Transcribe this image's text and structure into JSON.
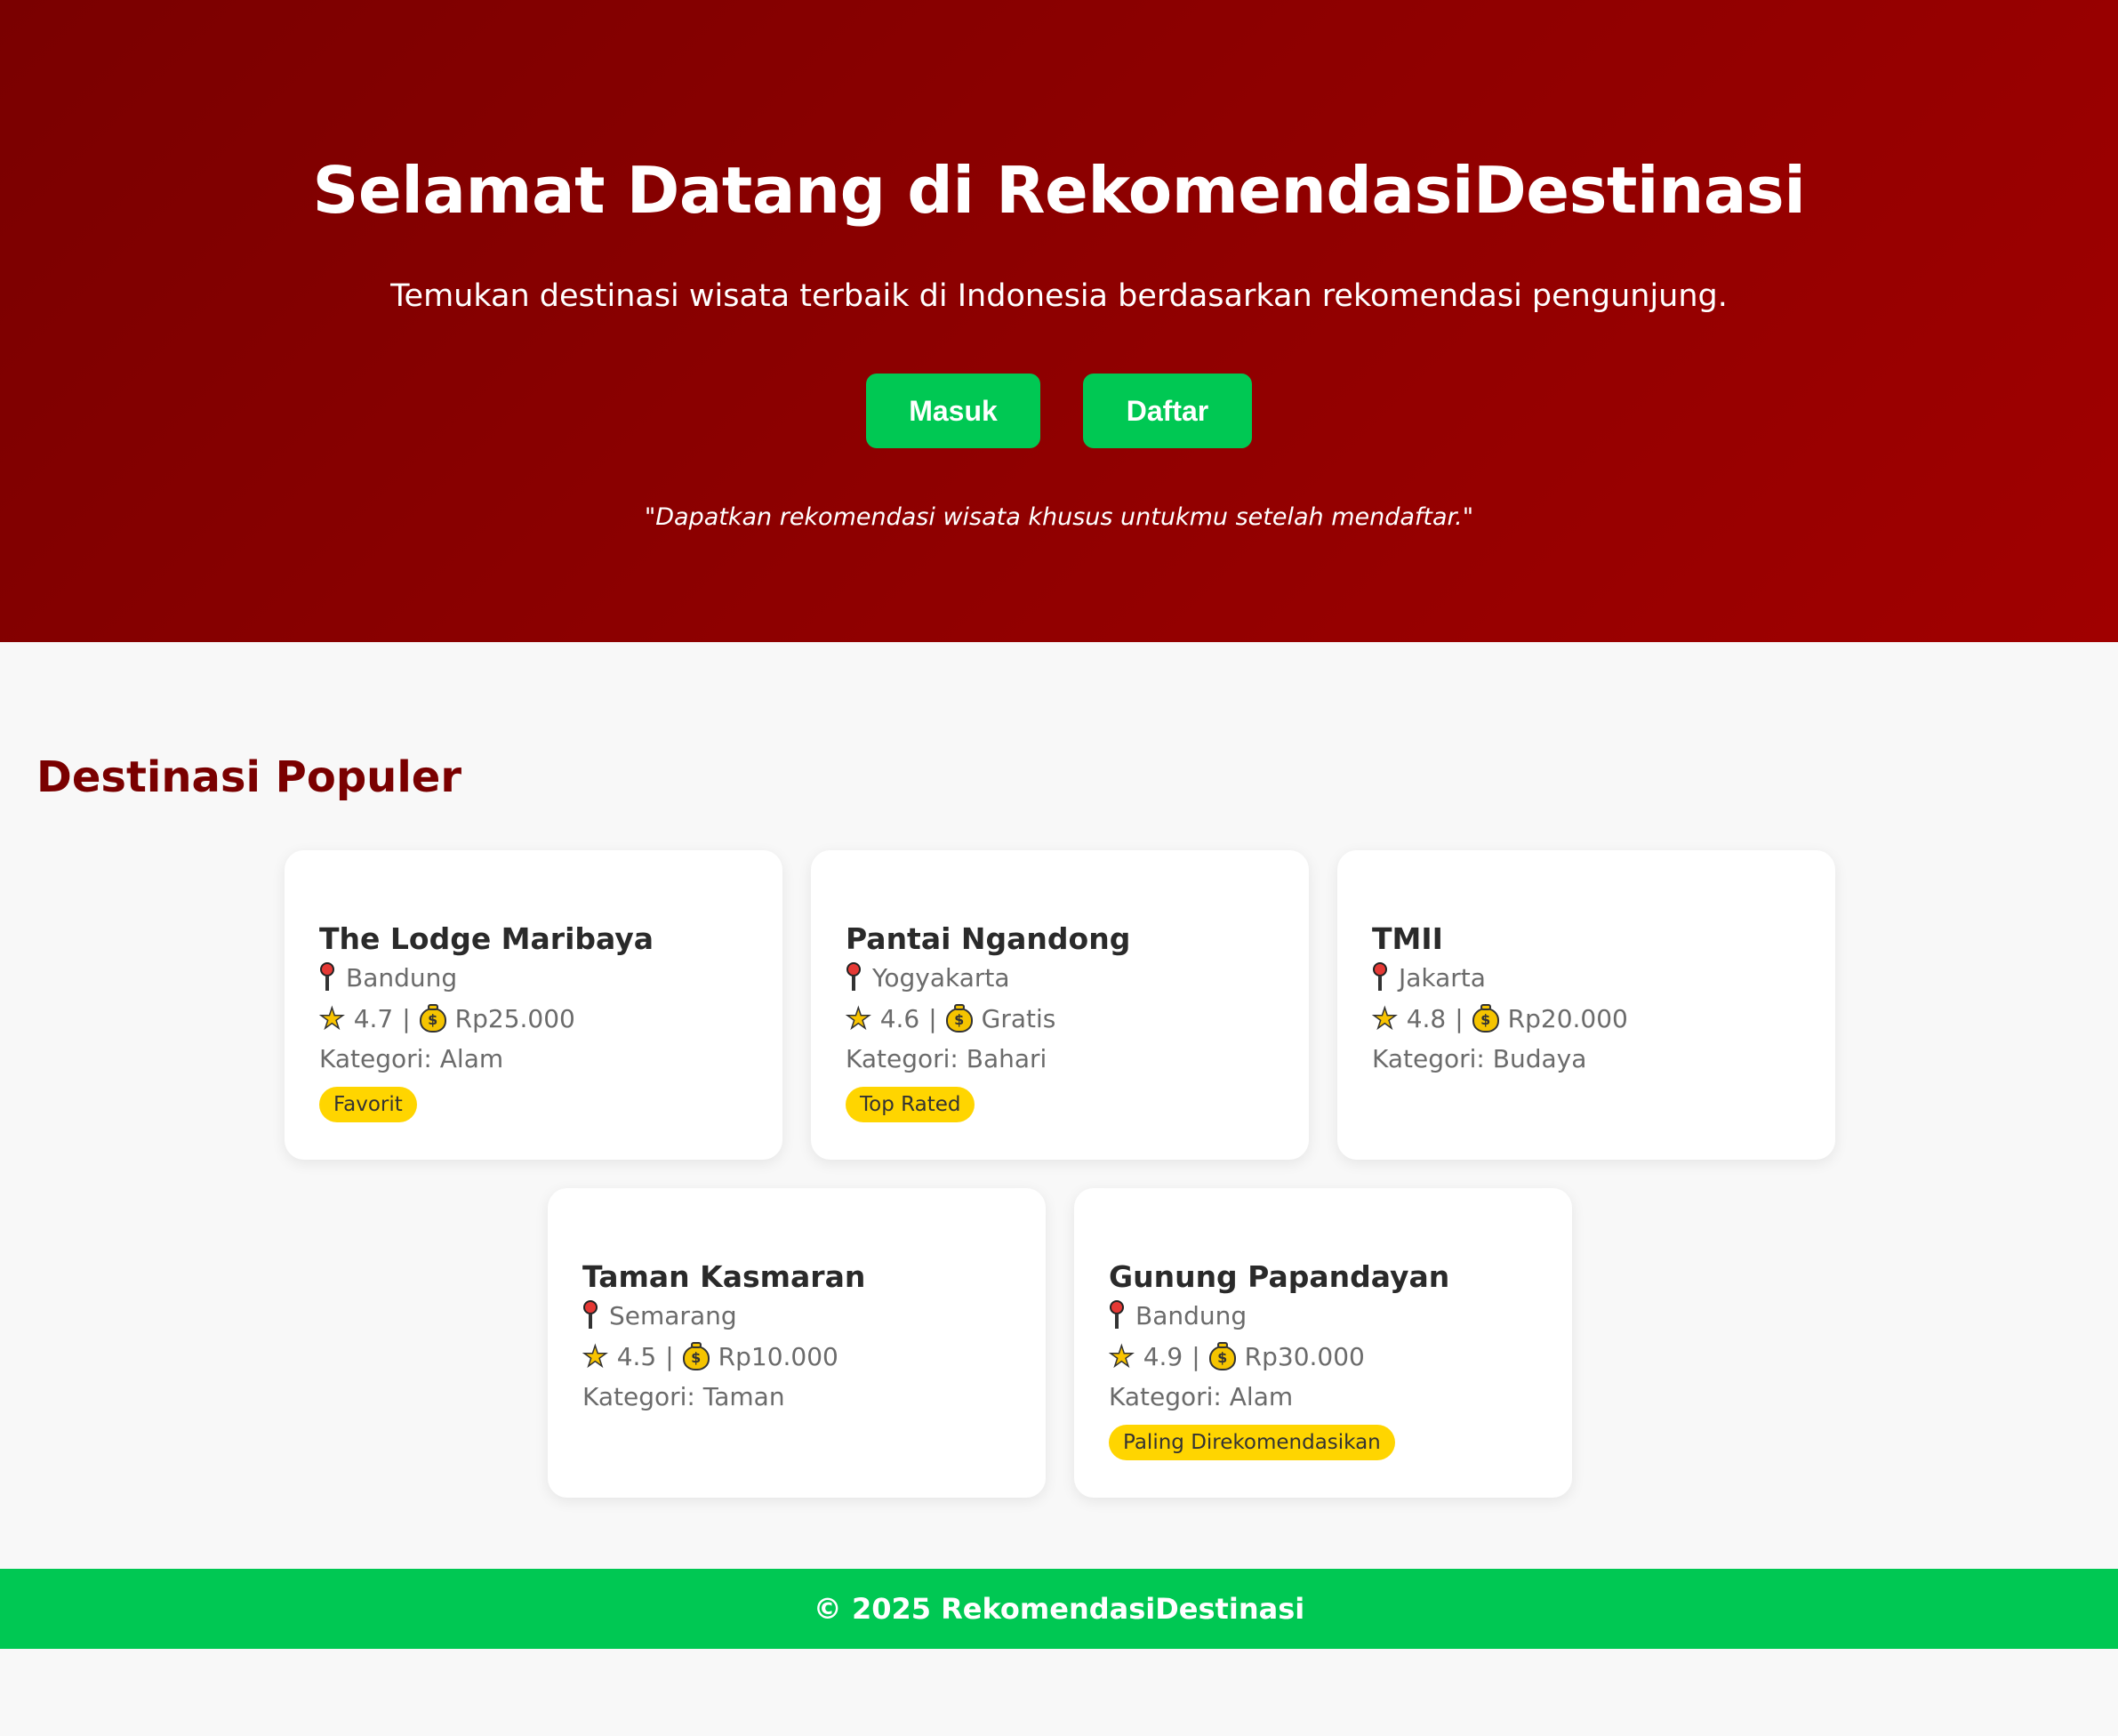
{
  "hero": {
    "title": "Selamat Datang di RekomendasiDestinasi",
    "subtitle": "Temukan destinasi wisata terbaik di Indonesia berdasarkan rekomendasi pengunjung.",
    "login_label": "Masuk",
    "register_label": "Daftar",
    "quote": "\"Dapatkan rekomendasi wisata khusus untukmu setelah mendaftar.\""
  },
  "section": {
    "title": "Destinasi Populer"
  },
  "destinations": [
    {
      "name": "The Lodge Maribaya",
      "location": "Bandung",
      "rating": "4.7",
      "price": "Rp25.000",
      "category": "Kategori: Alam",
      "badge": "Favorit"
    },
    {
      "name": "Pantai Ngandong",
      "location": "Yogyakarta",
      "rating": "4.6",
      "price": "Gratis",
      "category": "Kategori: Bahari",
      "badge": "Top Rated"
    },
    {
      "name": "TMII",
      "location": "Jakarta",
      "rating": "4.8",
      "price": "Rp20.000",
      "category": "Kategori: Budaya",
      "badge": ""
    },
    {
      "name": "Taman Kasmaran",
      "location": "Semarang",
      "rating": "4.5",
      "price": "Rp10.000",
      "category": "Kategori: Taman",
      "badge": ""
    },
    {
      "name": "Gunung Papandayan",
      "location": "Bandung",
      "rating": "4.9",
      "price": "Rp30.000",
      "category": "Kategori: Alam",
      "badge": "Paling Direkomendasikan"
    }
  ],
  "footer": {
    "text": "© 2025 RekomendasiDestinasi"
  },
  "colors": {
    "hero_bg": "#8b0000",
    "accent_green": "#00c853",
    "title_red": "#7a0000",
    "badge_yellow": "#ffd500"
  }
}
